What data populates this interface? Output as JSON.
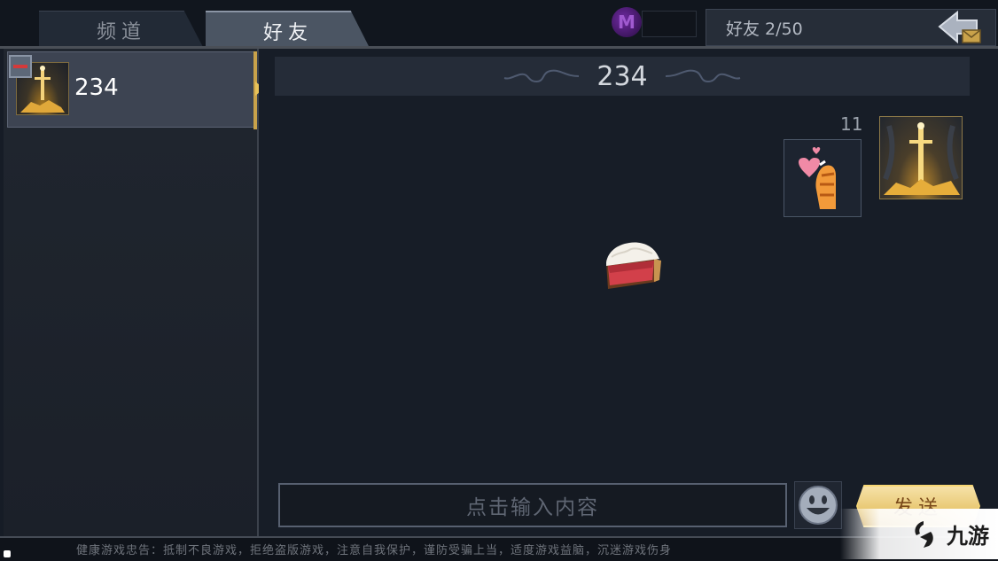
{
  "tabs": [
    {
      "label": "频道",
      "active": false
    },
    {
      "label": "好友",
      "active": true
    }
  ],
  "header": {
    "friend_count": "好友 2/50",
    "m_logo": "M"
  },
  "friends_list": [
    {
      "name": "234",
      "selected": true
    }
  ],
  "chat": {
    "title": "234",
    "message_count": "11",
    "stickers": [
      "heart-paw-sticker",
      "pie-sticker"
    ]
  },
  "input": {
    "placeholder": "点击输入内容",
    "send_label": "发送"
  },
  "footer": {
    "notice": "健康游戏忠告：抵制不良游戏，拒绝盗版游戏，注意自我保护，谨防受骗上当，适度游戏益脑，沉迷游戏伤身"
  },
  "watermark": {
    "text": "九游"
  },
  "colors": {
    "accent_gold": "#e8c771",
    "panel": "#252c38",
    "background": "#171d27"
  }
}
